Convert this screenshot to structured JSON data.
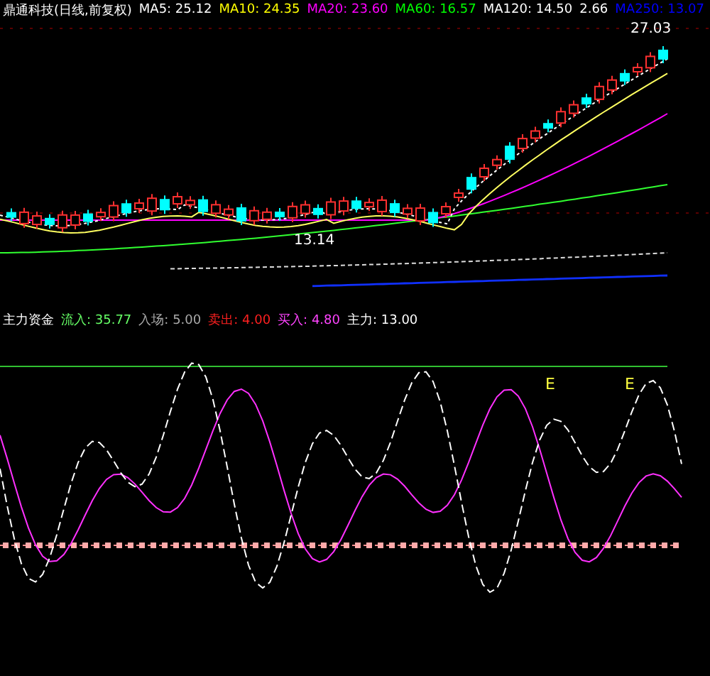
{
  "title": {
    "text": "鼎通科技(日线,前复权)"
  },
  "legend": [
    {
      "label": "MA5: 25.12",
      "color": "#ffffff"
    },
    {
      "label": "MA10: 24.35",
      "color": "#ffff00"
    },
    {
      "label": "MA20: 23.60",
      "color": "#ff00ff"
    },
    {
      "label": "MA60: 16.57",
      "color": "#00ff00"
    },
    {
      "label": "MA120: 14.50",
      "color": "#ffffff"
    },
    {
      "label": "2.66",
      "color": "#ffffff"
    },
    {
      "label": "MA250: 13.07",
      "color": "#0000ff"
    }
  ],
  "price_marks": {
    "high": "27.03",
    "low": "13.14"
  },
  "indicator": {
    "title": "主力资金",
    "legend": [
      {
        "label": "流入: 35.77",
        "color": "#66ff66"
      },
      {
        "label": "入场: 5.00",
        "color": "#aaaaaa"
      },
      {
        "label": "卖出: 4.00",
        "color": "#ff2020"
      },
      {
        "label": "买入: 4.80",
        "color": "#ff44ff"
      },
      {
        "label": "主力: 13.00",
        "color": "#ffffff"
      }
    ],
    "marks": [
      "E",
      "E"
    ]
  }
}
